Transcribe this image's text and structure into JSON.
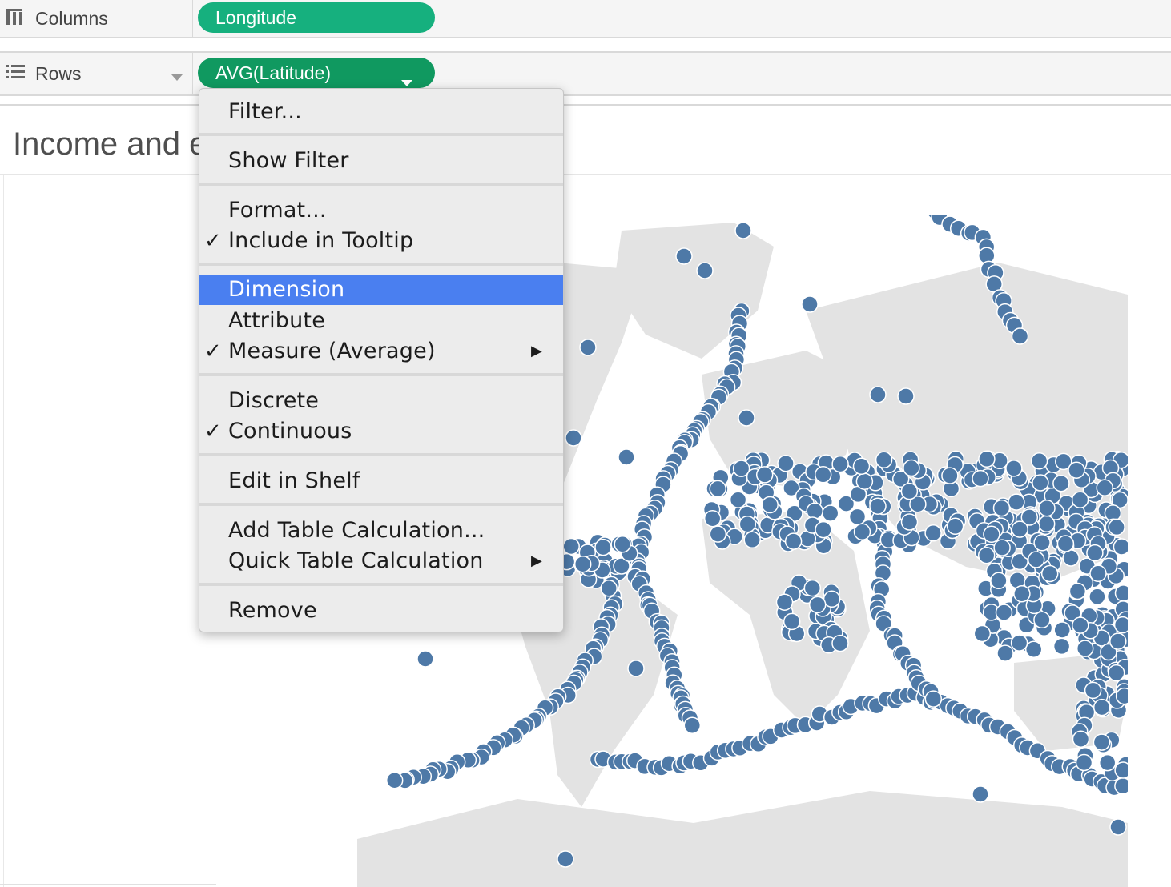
{
  "shelves": {
    "columns": {
      "label": "Columns",
      "pill": "Longitude"
    },
    "rows": {
      "label": "Rows",
      "pill": "AVG(Latitude)"
    }
  },
  "viz": {
    "title": "Income and e"
  },
  "context_menu": {
    "items": [
      {
        "label": "Filter...",
        "checked": false,
        "submenu": false,
        "highlighted": false
      },
      {
        "label": "Show Filter",
        "checked": false,
        "submenu": false,
        "highlighted": false
      },
      {
        "label": "Format...",
        "checked": false,
        "submenu": false,
        "highlighted": false
      },
      {
        "label": "Include in Tooltip",
        "checked": true,
        "submenu": false,
        "highlighted": false
      },
      {
        "label": "Dimension",
        "checked": false,
        "submenu": false,
        "highlighted": true
      },
      {
        "label": "Attribute",
        "checked": false,
        "submenu": false,
        "highlighted": false
      },
      {
        "label": "Measure (Average)",
        "checked": true,
        "submenu": true,
        "highlighted": false
      },
      {
        "label": "Discrete",
        "checked": false,
        "submenu": false,
        "highlighted": false
      },
      {
        "label": "Continuous",
        "checked": true,
        "submenu": false,
        "highlighted": false
      },
      {
        "label": "Edit in Shelf",
        "checked": false,
        "submenu": false,
        "highlighted": false
      },
      {
        "label": "Add Table Calculation...",
        "checked": false,
        "submenu": false,
        "highlighted": false
      },
      {
        "label": "Quick Table Calculation",
        "checked": false,
        "submenu": true,
        "highlighted": false
      },
      {
        "label": "Remove",
        "checked": false,
        "submenu": false,
        "highlighted": false
      }
    ],
    "check_glyph": "✓",
    "submenu_glyph": "▶"
  },
  "colors": {
    "pill_columns": "#16b07e",
    "pill_rows": "#109960",
    "menu_highlight": "#4a7ff0",
    "mark": "#4e79a7",
    "land": "#e3e3e3"
  },
  "icons": {
    "columns": "columns-icon",
    "rows": "rows-icon",
    "dropdown": "chevron-down-icon"
  }
}
